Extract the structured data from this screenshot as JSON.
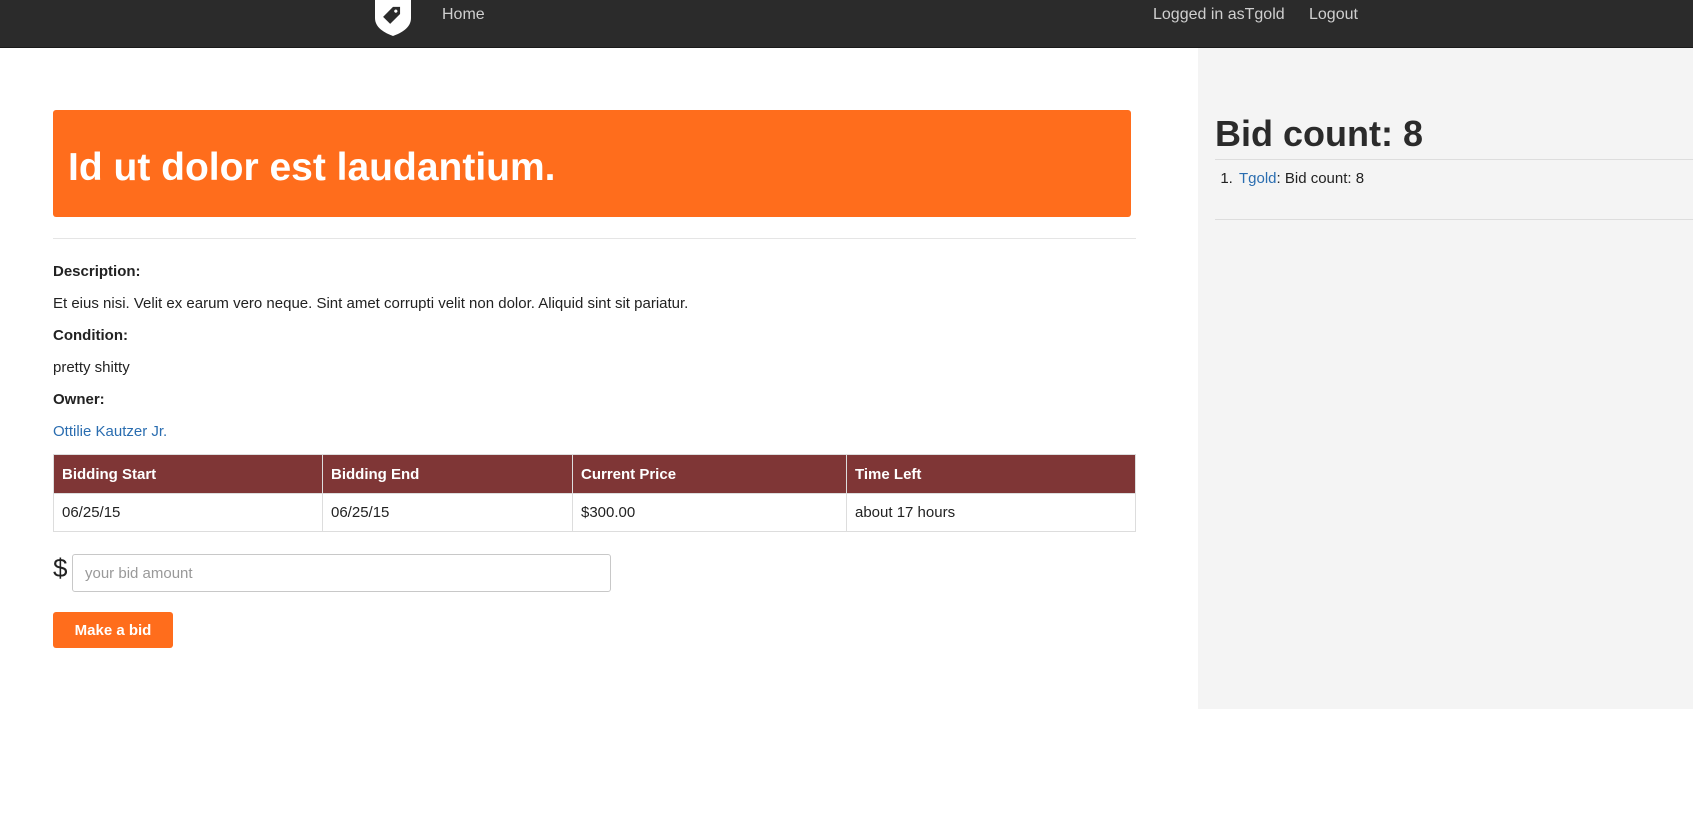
{
  "nav": {
    "home_label": "Home",
    "user_label": "Logged in asTgold",
    "logout_label": "Logout"
  },
  "item": {
    "title": "Id ut dolor est laudantium.",
    "description_label": "Description:",
    "description": "Et eius nisi. Velit ex earum vero neque. Sint amet corrupti velit non dolor. Aliquid sint sit pariatur.",
    "condition_label": "Condition:",
    "condition": "pretty shitty",
    "owner_label": "Owner:",
    "owner": "Ottilie Kautzer Jr."
  },
  "table": {
    "headers": [
      "Bidding Start",
      "Bidding End",
      "Current Price",
      "Time Left"
    ],
    "row": [
      "06/25/15",
      "06/25/15",
      "$300.00",
      "about 17 hours"
    ]
  },
  "bid_form": {
    "currency_symbol": "$",
    "placeholder": "your bid amount",
    "button_label": "Make a bid"
  },
  "sidebar": {
    "heading": "Bid count: 8",
    "bidders": [
      {
        "name": "Tgold",
        "text": ": Bid count: 8"
      }
    ]
  },
  "colors": {
    "accent": "#ff6d1c",
    "table_header": "#7f3636",
    "navbar": "#2b2b2b",
    "link": "#2a6db0"
  }
}
